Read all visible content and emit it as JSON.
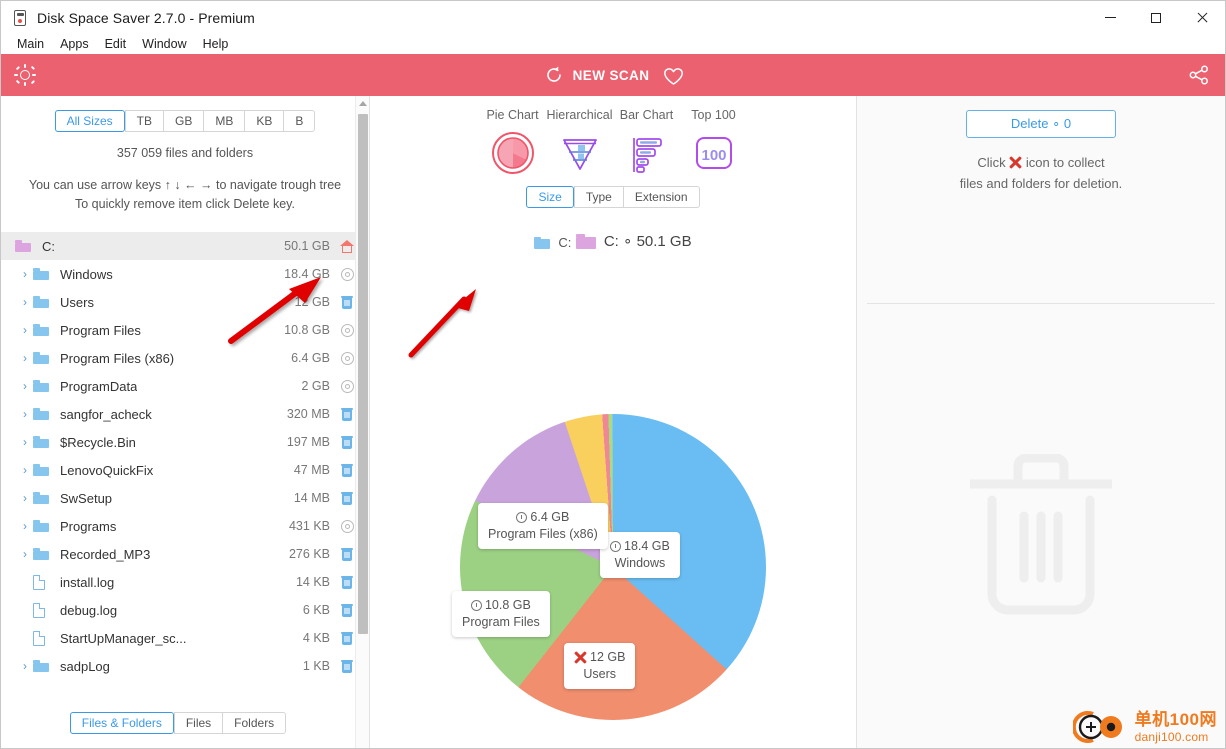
{
  "window": {
    "title": "Disk Space Saver 2.7.0 - Premium",
    "icon": "disk-icon",
    "controls": {
      "minimize": "—",
      "maximize": "□",
      "close": "✕"
    }
  },
  "menubar": {
    "items": [
      "Main",
      "Apps",
      "Edit",
      "Window",
      "Help"
    ]
  },
  "toolbar": {
    "brightness_icon": "sun-icon",
    "new_scan_label": "NEW SCAN",
    "refresh_icon": "refresh-icon",
    "favorite_icon": "heart-icon",
    "share_icon": "share-icon",
    "background": "#ec6170"
  },
  "left_panel": {
    "size_filter": {
      "options": [
        "All Sizes",
        "TB",
        "GB",
        "MB",
        "KB",
        "B"
      ],
      "selected": "All Sizes"
    },
    "count_text": "357 059 files and folders",
    "hint_line1": "You can use arrow keys ↑ ↓ ← → to navigate trough tree",
    "hint_line2": "To quickly remove item click Delete key.",
    "tree": [
      {
        "name": "C:",
        "size": "50.1 GB",
        "icon": "folder-pink",
        "action": "home-icon",
        "expander": "",
        "level": 0,
        "selected": true
      },
      {
        "name": "Windows",
        "size": "18.4 GB",
        "icon": "folder-blue",
        "action": "gear-icon",
        "expander": "›",
        "level": 1,
        "selected": false
      },
      {
        "name": "Users",
        "size": "12 GB",
        "icon": "folder-blue",
        "action": "trash-icon",
        "expander": "›",
        "level": 1,
        "selected": false
      },
      {
        "name": "Program Files",
        "size": "10.8 GB",
        "icon": "folder-blue",
        "action": "gear-icon",
        "expander": "›",
        "level": 1,
        "selected": false
      },
      {
        "name": "Program Files (x86)",
        "size": "6.4 GB",
        "icon": "folder-blue",
        "action": "gear-icon",
        "expander": "›",
        "level": 1,
        "selected": false
      },
      {
        "name": "ProgramData",
        "size": "2 GB",
        "icon": "folder-blue",
        "action": "gear-icon",
        "expander": "›",
        "level": 1,
        "selected": false
      },
      {
        "name": "sangfor_acheck",
        "size": "320 MB",
        "icon": "folder-blue",
        "action": "trash-icon",
        "expander": "›",
        "level": 1,
        "selected": false
      },
      {
        "name": "$Recycle.Bin",
        "size": "197 MB",
        "icon": "folder-blue",
        "action": "trash-icon",
        "expander": "›",
        "level": 1,
        "selected": false
      },
      {
        "name": "LenovoQuickFix",
        "size": "47 MB",
        "icon": "folder-blue",
        "action": "trash-icon",
        "expander": "›",
        "level": 1,
        "selected": false
      },
      {
        "name": "SwSetup",
        "size": "14 MB",
        "icon": "folder-blue",
        "action": "trash-icon",
        "expander": "›",
        "level": 1,
        "selected": false
      },
      {
        "name": "Programs",
        "size": "431 KB",
        "icon": "folder-blue",
        "action": "gear-icon",
        "expander": "›",
        "level": 1,
        "selected": false
      },
      {
        "name": "Recorded_MP3",
        "size": "276 KB",
        "icon": "folder-blue",
        "action": "trash-icon",
        "expander": "›",
        "level": 1,
        "selected": false
      },
      {
        "name": "install.log",
        "size": "14 KB",
        "icon": "file-icon",
        "action": "trash-icon",
        "expander": "",
        "level": 1,
        "selected": false
      },
      {
        "name": "debug.log",
        "size": "6 KB",
        "icon": "file-icon",
        "action": "trash-icon",
        "expander": "",
        "level": 1,
        "selected": false
      },
      {
        "name": "StartUpManager_sc...",
        "size": "4 KB",
        "icon": "file-icon",
        "action": "trash-icon",
        "expander": "",
        "level": 1,
        "selected": false
      },
      {
        "name": "sadpLog",
        "size": "1 KB",
        "icon": "folder-blue",
        "action": "trash-icon",
        "expander": "›",
        "level": 1,
        "selected": false
      }
    ],
    "bottom_filter": {
      "options": [
        "Files & Folders",
        "Files",
        "Folders"
      ],
      "selected": "Files & Folders"
    }
  },
  "center_panel": {
    "view_tabs": [
      {
        "label": "Pie Chart",
        "icon": "pie-chart-icon",
        "active": true
      },
      {
        "label": "Hierarchical",
        "icon": "funnel-icon",
        "active": false
      },
      {
        "label": "Bar Chart",
        "icon": "bar-chart-icon",
        "active": false
      },
      {
        "label": "Top 100",
        "icon": "top100-icon",
        "active": false
      }
    ],
    "mode_filter": {
      "options": [
        "Size",
        "Type",
        "Extension"
      ],
      "selected": "Size"
    },
    "breadcrumb_top": "C:",
    "breadcrumb_main": "C: ∘ 50.1 GB"
  },
  "chart_data": {
    "type": "pie",
    "title": "C: ∘ 50.1 GB",
    "unit": "GB",
    "total": 50.1,
    "legend_position": "on-slice-labels",
    "categories": [
      "Windows",
      "Users",
      "Program Files",
      "Program Files (x86)",
      "ProgramData",
      "sangfor_acheck",
      "$Recycle.Bin",
      "LenovoQuickFix"
    ],
    "values": [
      18.4,
      12,
      10.8,
      6.4,
      2,
      0.32,
      0.197,
      0.047
    ],
    "colors": [
      "#69bdf2",
      "#f08e6e",
      "#9cd183",
      "#c9a3dc",
      "#f9cf5e",
      "#ef8796",
      "#aadb7f",
      "#7ec9ef"
    ],
    "labels": [
      {
        "value": "18.4 GB",
        "name": "Windows",
        "badge": "clock-icon"
      },
      {
        "value": "12 GB",
        "name": "Users",
        "badge": "x-icon"
      },
      {
        "value": "10.8 GB",
        "name": "Program Files",
        "badge": "clock-icon"
      },
      {
        "value": "6.4 GB",
        "name": "Program Files (x86)",
        "badge": "clock-icon"
      }
    ]
  },
  "right_panel": {
    "delete_button": "Delete ∘ 0",
    "hint_line1_pre": "Click",
    "hint_line1_post": "icon to collect",
    "hint_line2": "files and folders for deletion.",
    "ghost_icon": "trash-icon"
  },
  "watermark": {
    "cn": "单机100网",
    "en": "danji100.com",
    "color": "#f07a1e"
  }
}
